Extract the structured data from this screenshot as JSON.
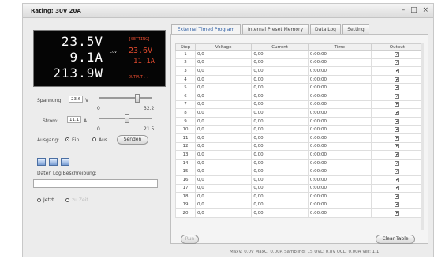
{
  "window": {
    "title": "Rating: 30V 20A",
    "controls": [
      "–",
      "□",
      "×"
    ]
  },
  "lcd": {
    "voltage": "23.5V",
    "current": "9.1A",
    "power": "213.9W",
    "setting_label": "[SETTING]",
    "mode": "ccv",
    "set_voltage": "23.6V",
    "set_current": "11.1A",
    "output": "OUTPUT→→"
  },
  "controls": {
    "voltage_label": "Spannung:",
    "voltage_value": "23.6",
    "voltage_unit": "V",
    "voltage_min": "0",
    "voltage_max": "32.2",
    "voltage_level": 0.73,
    "current_label": "Strom:",
    "current_value": "11.1",
    "current_unit": "A",
    "current_min": "0",
    "current_max": "21.5",
    "current_level": 0.52,
    "output_label": "Ausgang:",
    "on_label": "Ein",
    "off_label": "Aus",
    "send_button": "Senden",
    "log_description_label": "Daten Log Beschreibung:",
    "log_description_value": "",
    "now_label": "Jetzt",
    "scheduled_label": "zu Zeit"
  },
  "tabs": [
    "External Timed Program",
    "Internal Preset Memory",
    "Data Log",
    "Setting"
  ],
  "table": {
    "headers": [
      "Step",
      "Voltage",
      "Current",
      "Time",
      "Output"
    ],
    "rows": [
      [
        "1",
        "0,0",
        "0,00",
        "0:00:00",
        "✔"
      ],
      [
        "2",
        "0,0",
        "0,00",
        "0:00:00",
        "✔"
      ],
      [
        "3",
        "0,0",
        "0,00",
        "0:00:00",
        "✔"
      ],
      [
        "4",
        "0,0",
        "0,00",
        "0:00:00",
        "✔"
      ],
      [
        "5",
        "0,0",
        "0,00",
        "0:00:00",
        "✔"
      ],
      [
        "6",
        "0,0",
        "0,00",
        "0:00:00",
        "✔"
      ],
      [
        "7",
        "0,0",
        "0,00",
        "0:00:00",
        "✔"
      ],
      [
        "8",
        "0,0",
        "0,00",
        "0:00:00",
        "✔"
      ],
      [
        "9",
        "0,0",
        "0,00",
        "0:00:00",
        "✔"
      ],
      [
        "10",
        "0,0",
        "0,00",
        "0:00:00",
        "✔"
      ],
      [
        "11",
        "0,0",
        "0,00",
        "0:00:00",
        "✔"
      ],
      [
        "12",
        "0,0",
        "0,00",
        "0:00:00",
        "✔"
      ],
      [
        "13",
        "0,0",
        "0,00",
        "0:00:00",
        "✔"
      ],
      [
        "14",
        "0,0",
        "0,00",
        "0:00:00",
        "✔"
      ],
      [
        "15",
        "0,0",
        "0,00",
        "0:00:00",
        "✔"
      ],
      [
        "16",
        "0,0",
        "0,00",
        "0:00:00",
        "✔"
      ],
      [
        "17",
        "0,0",
        "0,00",
        "0:00:00",
        "✔"
      ],
      [
        "18",
        "0,0",
        "0,00",
        "0:00:00",
        "✔"
      ],
      [
        "19",
        "0,0",
        "0,00",
        "0:00:00",
        "✔"
      ],
      [
        "20",
        "0,0",
        "0,00",
        "0:00:00",
        "✔"
      ]
    ]
  },
  "buttons": {
    "run": "Run",
    "clear_table": "Clear Table"
  },
  "status": "MaxV: 0.0V  MaxC: 0.00A  Sampling: 1S  UVL: 0.8V  UCL: 0.00A  Ver: 1.1"
}
